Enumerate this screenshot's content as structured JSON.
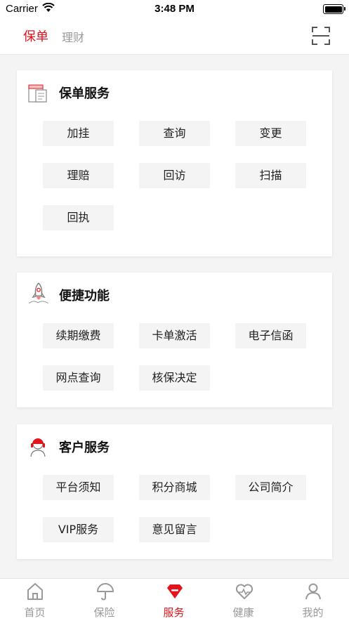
{
  "status_bar": {
    "carrier": "Carrier",
    "time": "3:48 PM"
  },
  "top_tabs": {
    "active": "保单",
    "inactive": "理财"
  },
  "cards": {
    "policy": {
      "title": "保单服务",
      "buttons": [
        "加挂",
        "查询",
        "变更",
        "理赔",
        "回访",
        "扫描",
        "回执"
      ]
    },
    "quick": {
      "title": "便捷功能",
      "buttons": [
        "续期缴费",
        "卡单激活",
        "电子信函",
        "网点查询",
        "核保决定"
      ]
    },
    "customer": {
      "title": "客户服务",
      "buttons": [
        "平台须知",
        "积分商城",
        "公司简介",
        "VIP服务",
        "意见留言"
      ]
    }
  },
  "tab_bar": {
    "items": [
      {
        "label": "首页",
        "icon": "home-icon"
      },
      {
        "label": "保险",
        "icon": "umbrella-icon"
      },
      {
        "label": "服务",
        "icon": "service-icon"
      },
      {
        "label": "健康",
        "icon": "heart-pulse-icon"
      },
      {
        "label": "我的",
        "icon": "profile-icon"
      }
    ],
    "active_index": 2
  },
  "colors": {
    "accent": "#e4141c",
    "inactive": "#999999",
    "button_bg": "#f4f4f4"
  }
}
